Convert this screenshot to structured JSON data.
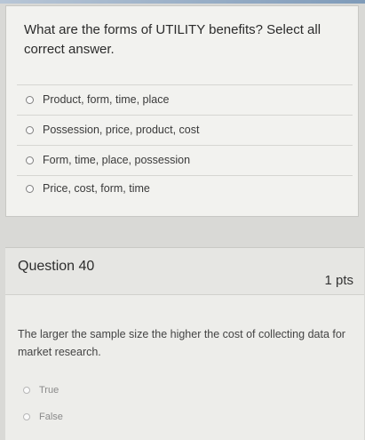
{
  "question_prev": {
    "prompt": "What are the forms of UTILITY benefits? Select all correct answer.",
    "answers": [
      "Product, form, time, place",
      "Possession, price, product, cost",
      "Form, time, place, possession",
      "Price, cost, form, time"
    ]
  },
  "question_40": {
    "title": "Question 40",
    "points": "1 pts",
    "prompt": "The larger the sample size the higher the cost of collecting data for market research.",
    "answers": [
      "True",
      "False"
    ]
  }
}
